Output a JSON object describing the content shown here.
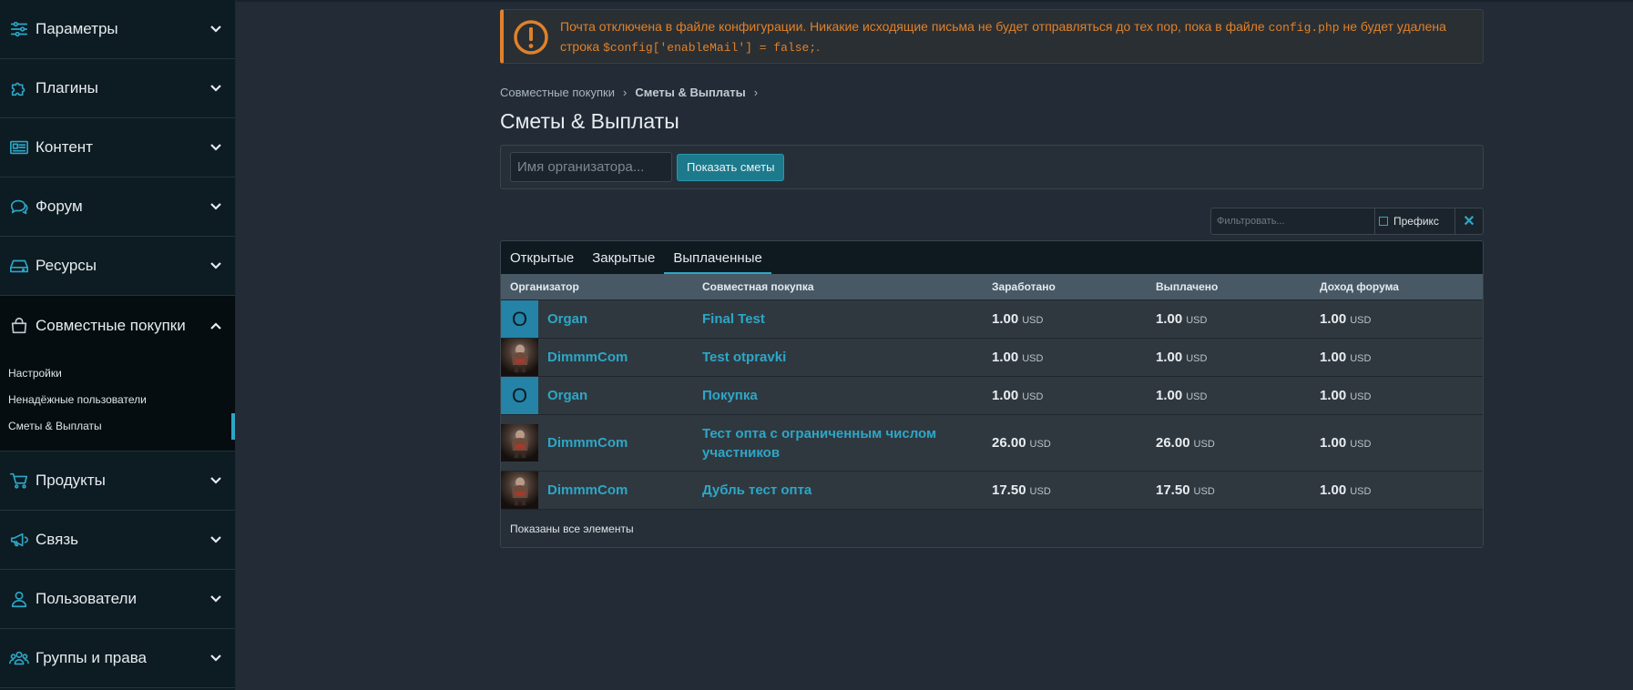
{
  "sidebar": {
    "items": [
      {
        "label": "Параметры",
        "icon": "sliders-icon"
      },
      {
        "label": "Плагины",
        "icon": "puzzle-icon"
      },
      {
        "label": "Контент",
        "icon": "newspaper-icon"
      },
      {
        "label": "Форум",
        "icon": "comments-icon"
      },
      {
        "label": "Ресурсы",
        "icon": "hdd-icon"
      },
      {
        "label": "Совместные покупки",
        "icon": "shopping-bag-icon"
      },
      {
        "label": "Продукты",
        "icon": "cart-icon"
      },
      {
        "label": "Связь",
        "icon": "bullhorn-icon"
      },
      {
        "label": "Пользователи",
        "icon": "user-icon"
      },
      {
        "label": "Группы и права",
        "icon": "users-icon"
      }
    ],
    "subitems": [
      "Настройки",
      "Ненадёжные пользователи",
      "Сметы & Выплаты"
    ]
  },
  "alert": {
    "text1": "Почта отключена в файле конфигурации. Никакие исходящие письма не будет отправляться до тех пор, пока в файле",
    "code1": "config.php",
    "text2": "не будет удалена строка",
    "code2": "$config['enableMail'] = false;",
    "text3": ".",
    "color": "#e0812b"
  },
  "breadcrumb": {
    "item1": "Совместные покупки",
    "item2": "Сметы & Выплаты"
  },
  "page_title": "Сметы & Выплаты",
  "filter": {
    "placeholder": "Имя организатора...",
    "button": "Показать сметы"
  },
  "quickfilter": {
    "placeholder": "Фильтровать...",
    "prefix": "Префикс",
    "clear": "✕"
  },
  "tabs": [
    "Открытые",
    "Закрытые",
    "Выплаченные"
  ],
  "table": {
    "headers": [
      "Организатор",
      "Совместная покупка",
      "Заработано",
      "Выплачено",
      "Доход форума"
    ],
    "rows": [
      {
        "avatar": "O",
        "org": "Organ",
        "buy": "Final Test",
        "earned": "1.00",
        "paid": "1.00",
        "income": "1.00",
        "cur": "USD"
      },
      {
        "avatar": "",
        "org": "DimmmCom",
        "buy": "Test otpravki",
        "earned": "1.00",
        "paid": "1.00",
        "income": "1.00",
        "cur": "USD"
      },
      {
        "avatar": "O",
        "org": "Organ",
        "buy": "Покупка",
        "earned": "1.00",
        "paid": "1.00",
        "income": "1.00",
        "cur": "USD"
      },
      {
        "avatar": "",
        "org": "DimmmCom",
        "buy": "Тест опта с ограниченным числом участников",
        "earned": "26.00",
        "paid": "26.00",
        "income": "1.00",
        "cur": "USD"
      },
      {
        "avatar": "",
        "org": "DimmmCom",
        "buy": "Дубль тест опта",
        "earned": "17.50",
        "paid": "17.50",
        "income": "1.00",
        "cur": "USD"
      }
    ],
    "footer": "Показаны все элементы"
  },
  "colors": {
    "accent": "#2ca7c7",
    "sidebar_bg": "#0d1b22",
    "page_bg": "#222b36",
    "warning": "#e0812b"
  }
}
